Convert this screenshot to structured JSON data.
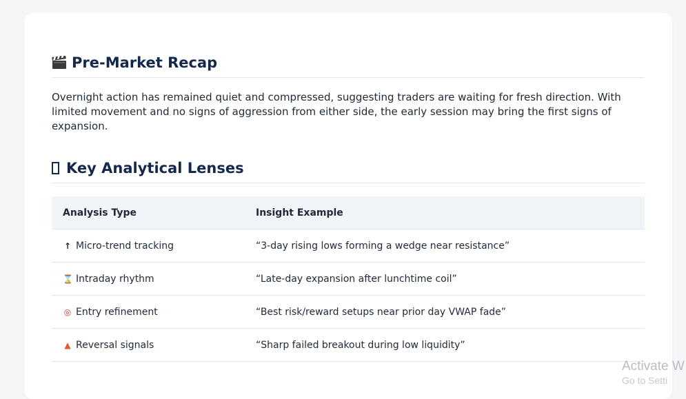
{
  "recap": {
    "icon": "clapperboard-icon",
    "title": "Pre-Market Recap",
    "body": "Overnight action has remained quiet and compressed, suggesting traders are waiting for fresh direction. With limited movement and no signs of aggression from either side, the early session may bring the first signs of expansion."
  },
  "lenses": {
    "icon": "missing-glyph-box-icon",
    "title": "Key Analytical Lenses",
    "table": {
      "headers": [
        "Analysis Type",
        "Insight Example"
      ],
      "rows": [
        {
          "icon": "up-arrow-icon",
          "glyph": "↑",
          "type": "Micro-trend tracking",
          "insight": "“3-day rising lows forming a wedge near resistance”"
        },
        {
          "icon": "hourglass-icon",
          "glyph": "⌛",
          "type": "Intraday rhythm",
          "insight": "“Late-day expansion after lunchtime coil”"
        },
        {
          "icon": "target-icon",
          "glyph": "◎",
          "type": "Entry refinement",
          "insight": "“Best risk/reward setups near prior day VWAP fade”"
        },
        {
          "icon": "siren-icon",
          "glyph": "▲",
          "type": "Reversal signals",
          "insight": "“Sharp failed breakout during low liquidity”"
        }
      ]
    }
  },
  "watermark": {
    "line1": "Activate W",
    "line2": "Go to Setti"
  }
}
